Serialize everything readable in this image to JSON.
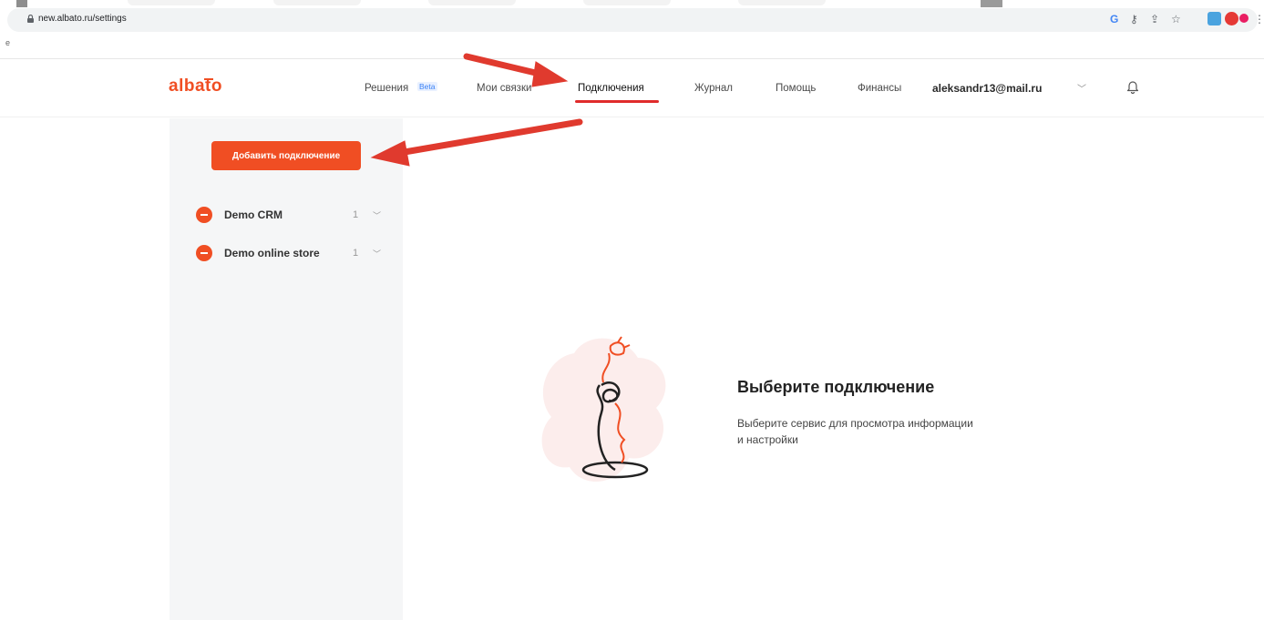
{
  "browser": {
    "url": "new.albato.ru/settings"
  },
  "header": {
    "logo": "albato",
    "nav": [
      {
        "label": "Решения",
        "badge": "Beta"
      },
      {
        "label": "Мои связки"
      },
      {
        "label": "Подключения",
        "active": true
      },
      {
        "label": "Журнал"
      },
      {
        "label": "Помощь"
      },
      {
        "label": "Финансы"
      }
    ],
    "user_email": "aleksandr13@mail.ru"
  },
  "sidebar": {
    "add_button": "Добавить подключение",
    "connections": [
      {
        "name": "Demo CRM",
        "count": "1"
      },
      {
        "name": "Demo online store",
        "count": "1"
      }
    ]
  },
  "empty_state": {
    "title": "Выберите подключение",
    "description_line1": "Выберите сервис для просмотра информации",
    "description_line2": "и настройки"
  },
  "colors": {
    "brand": "#f04e23",
    "annotation": "#e03a2e"
  }
}
